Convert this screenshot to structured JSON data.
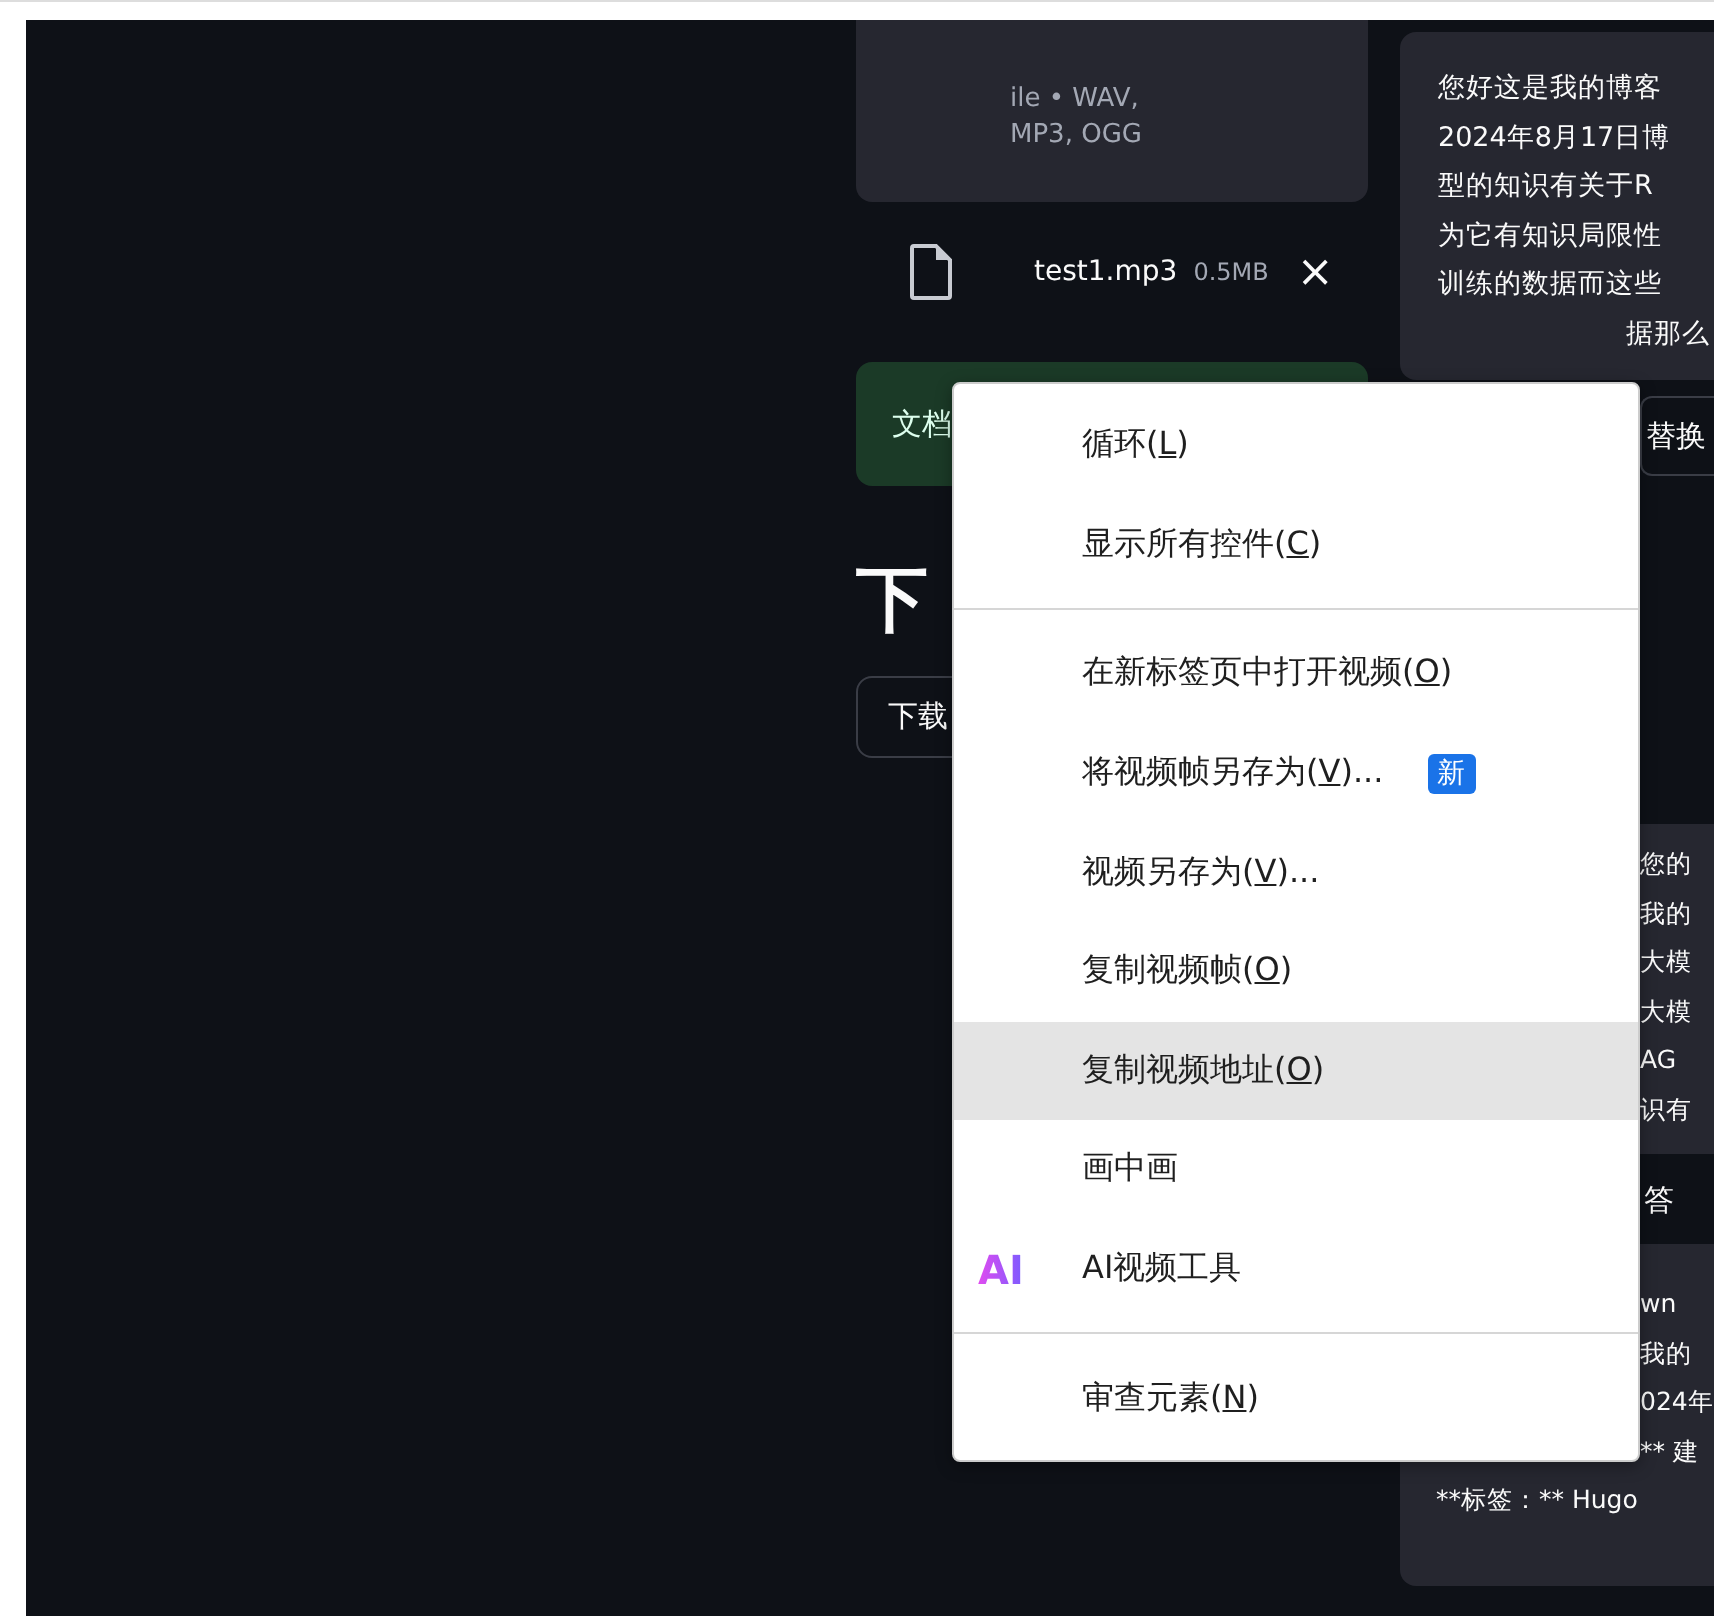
{
  "upload_card": {
    "lines": [
      "ile • WAV,",
      "MP3, OGG"
    ]
  },
  "file": {
    "name": "test1.mp3",
    "size": "0.5MB",
    "remove": "×"
  },
  "doc_button": {
    "label": "文档"
  },
  "heading": "下",
  "download_button": {
    "label": "下载"
  },
  "chat_cards": [
    {
      "lines": [
        "您好这是我的博客",
        "2024年8月17日博",
        "型的知识有关于R",
        "为它有知识局限性",
        "训练的数据而这些",
        "据那么"
      ]
    },
    {
      "lines": [
        "替换"
      ],
      "kind": "button"
    },
    {
      "lines": [
        "您的",
        "我的",
        "大模",
        "大模",
        "AG",
        "识有"
      ]
    },
    {
      "lines": [
        "答"
      ],
      "kind": "plain"
    },
    {
      "lines": [
        "wn",
        "我的",
        "024年",
        "** 建",
        "**标签：** Hugo"
      ]
    }
  ],
  "context_menu": {
    "items": [
      {
        "kind": "item",
        "before": "循环(",
        "accel": "L",
        "after": ")",
        "selected": false
      },
      {
        "kind": "item",
        "before": "显示所有控件(",
        "accel": "C",
        "after": ")",
        "selected": false
      },
      {
        "kind": "separator"
      },
      {
        "kind": "item",
        "before": "在新标签页中打开视频(",
        "accel": "O",
        "after": ")",
        "selected": false
      },
      {
        "kind": "item",
        "before": "将视频帧另存为(",
        "accel": "V",
        "after": ")...",
        "badge": "新",
        "selected": false
      },
      {
        "kind": "item",
        "before": "视频另存为(",
        "accel": "V",
        "after": ")...",
        "selected": false
      },
      {
        "kind": "item",
        "before": "复制视频帧(",
        "accel": "O",
        "after": ")",
        "selected": false
      },
      {
        "kind": "item",
        "before": "复制视频地址(",
        "accel": "O",
        "after": ")",
        "selected": true
      },
      {
        "kind": "item",
        "before": "画中画",
        "selected": false
      },
      {
        "kind": "item",
        "before": "AI视频工具",
        "icon_text": "AI",
        "selected": false
      },
      {
        "kind": "separator"
      },
      {
        "kind": "item",
        "before": "审查元素(",
        "accel": "N",
        "after": ")",
        "selected": false
      }
    ]
  }
}
